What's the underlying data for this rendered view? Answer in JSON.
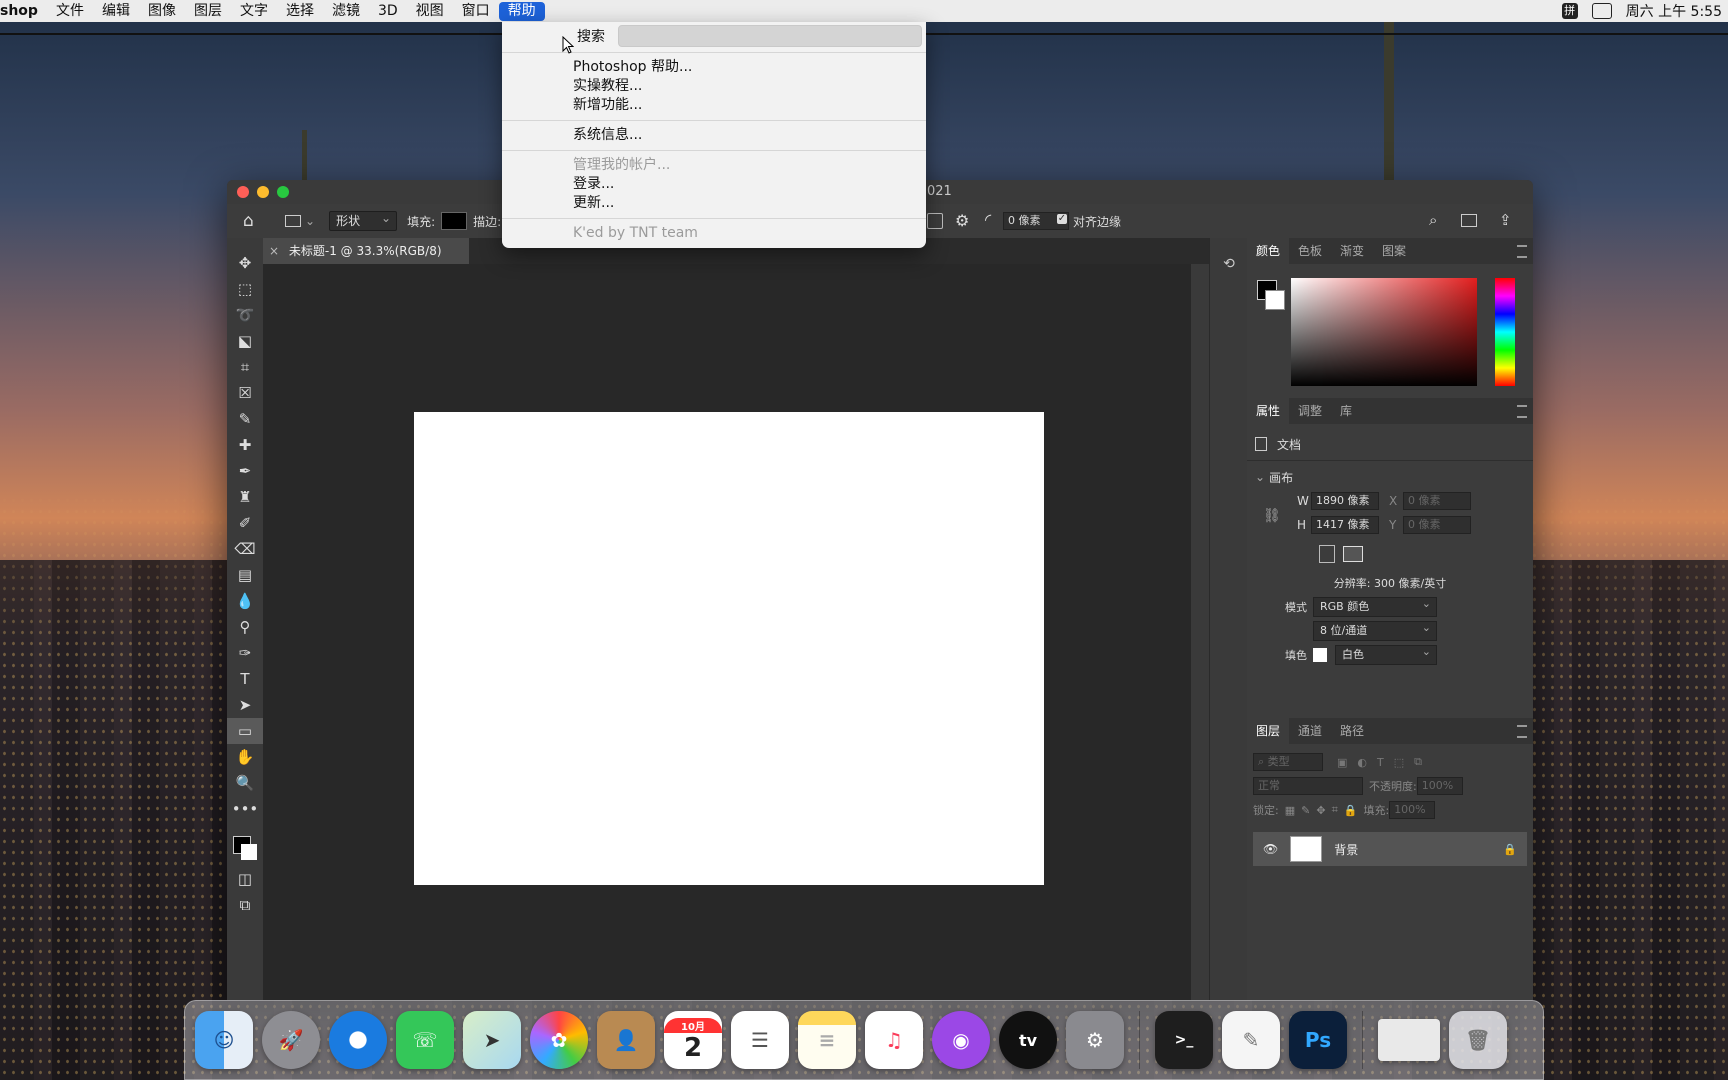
{
  "menubar": {
    "app": "shop",
    "items": [
      "文件",
      "编辑",
      "图像",
      "图层",
      "文字",
      "选择",
      "滤镜",
      "3D",
      "视图",
      "窗口",
      "帮助"
    ],
    "clock": "周六 上午 5:55"
  },
  "help_menu": {
    "search_label": "搜索",
    "items": [
      {
        "label": "Photoshop 帮助...",
        "enabled": true
      },
      {
        "label": "实操教程...",
        "enabled": true
      },
      {
        "label": "新增功能...",
        "enabled": true
      },
      {
        "label": "系统信息...",
        "enabled": true
      },
      {
        "label": "管理我的帐户...",
        "enabled": false
      },
      {
        "label": "登录...",
        "enabled": true
      },
      {
        "label": "更新...",
        "enabled": true
      },
      {
        "label": "K'ed by TNT team",
        "enabled": false
      }
    ]
  },
  "window": {
    "title_fragment": "021"
  },
  "options_bar": {
    "mode": "形状",
    "fill_label": "填充:",
    "stroke_label": "描边:",
    "radius_value": "0 像素",
    "align_edges": "对齐边缘"
  },
  "document": {
    "tab_title": "未标题-1 @ 33.3%(RGB/8)"
  },
  "color_panel": {
    "tabs": [
      "颜色",
      "色板",
      "渐变",
      "图案"
    ],
    "colors": {
      "accent": "#1d62d9",
      "foreground": "#000000",
      "background": "#ffffff"
    }
  },
  "properties_panel": {
    "tabs": [
      "属性",
      "调整",
      "库"
    ],
    "doc_label": "文档",
    "canvas_section": "画布",
    "w_label": "W",
    "w_value": "1890 像素",
    "h_label": "H",
    "h_value": "1417 像素",
    "x_label": "X",
    "x_placeholder": "0 像素",
    "y_label": "Y",
    "y_placeholder": "0 像素",
    "resolution": "分辨率: 300 像素/英寸",
    "mode_label": "模式",
    "mode_value": "RGB 颜色",
    "depth_value": "8 位/通道",
    "fill_label": "填色",
    "fill_value": "白色"
  },
  "layers_panel": {
    "tabs": [
      "图层",
      "通道",
      "路径"
    ],
    "filter_placeholder": "类型",
    "blend_mode": "正常",
    "opacity_label": "不透明度:",
    "opacity_value": "100%",
    "lock_label": "锁定:",
    "fill_label": "填充:",
    "fill_value": "100%",
    "layer_name": "背景"
  },
  "dock": {
    "calendar_month": "10月",
    "calendar_day": "2",
    "tv_label": "tv",
    "ps_label": "Ps"
  }
}
